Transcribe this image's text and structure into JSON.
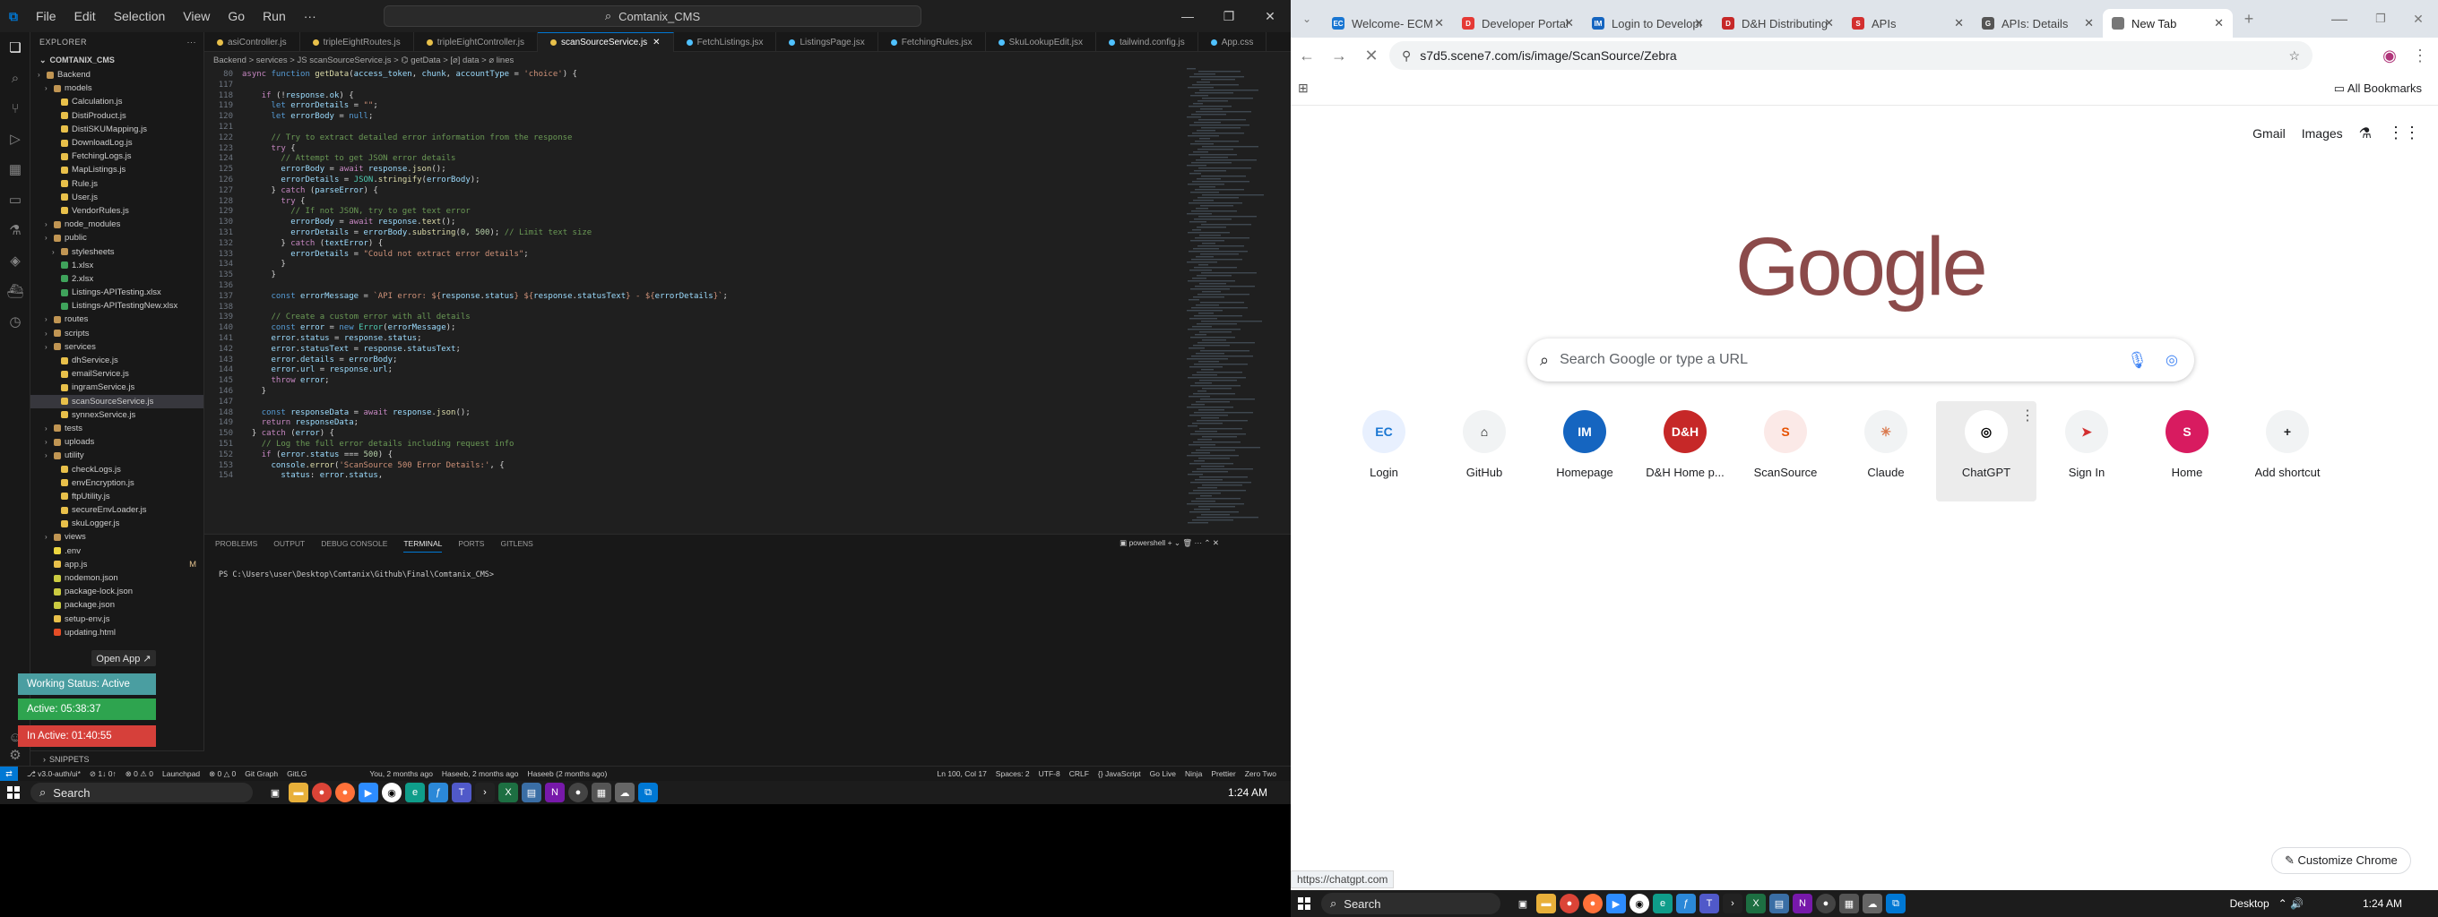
{
  "vscode": {
    "menus": [
      "File",
      "Edit",
      "Selection",
      "View",
      "Go",
      "Run",
      "···"
    ],
    "search": "Comtanix_CMS",
    "explorer_title": "EXPLORER",
    "root_folder": "COMTANIX_CMS",
    "tree": [
      {
        "label": "Backend",
        "type": "folder",
        "depth": 1
      },
      {
        "label": "models",
        "type": "folder",
        "depth": 2
      },
      {
        "label": "Calculation.js",
        "type": "js",
        "depth": 3
      },
      {
        "label": "DistiProduct.js",
        "type": "js",
        "depth": 3
      },
      {
        "label": "DistiSKUMapping.js",
        "type": "js",
        "depth": 3
      },
      {
        "label": "DownloadLog.js",
        "type": "js",
        "depth": 3
      },
      {
        "label": "FetchingLogs.js",
        "type": "js",
        "depth": 3
      },
      {
        "label": "MapListings.js",
        "type": "js",
        "depth": 3
      },
      {
        "label": "Rule.js",
        "type": "js",
        "depth": 3
      },
      {
        "label": "User.js",
        "type": "js",
        "depth": 3
      },
      {
        "label": "VendorRules.js",
        "type": "js",
        "depth": 3
      },
      {
        "label": "node_modules",
        "type": "folder",
        "depth": 2
      },
      {
        "label": "public",
        "type": "folder",
        "depth": 2
      },
      {
        "label": "stylesheets",
        "type": "folder",
        "depth": 3
      },
      {
        "label": "1.xlsx",
        "type": "xlsx",
        "depth": 3
      },
      {
        "label": "2.xlsx",
        "type": "xlsx",
        "depth": 3
      },
      {
        "label": "Listings-APITesting.xlsx",
        "type": "xlsx",
        "depth": 3
      },
      {
        "label": "Listings-APITestingNew.xlsx",
        "type": "xlsx",
        "depth": 3
      },
      {
        "label": "routes",
        "type": "folder",
        "depth": 2
      },
      {
        "label": "scripts",
        "type": "folder",
        "depth": 2
      },
      {
        "label": "services",
        "type": "folder",
        "depth": 2
      },
      {
        "label": "dhService.js",
        "type": "js",
        "depth": 3
      },
      {
        "label": "emailService.js",
        "type": "js",
        "depth": 3
      },
      {
        "label": "ingramService.js",
        "type": "js",
        "depth": 3
      },
      {
        "label": "scanSourceService.js",
        "type": "js",
        "depth": 3,
        "selected": true
      },
      {
        "label": "synnexService.js",
        "type": "js",
        "depth": 3
      },
      {
        "label": "tests",
        "type": "folder",
        "depth": 2
      },
      {
        "label": "uploads",
        "type": "folder",
        "depth": 2
      },
      {
        "label": "utility",
        "type": "folder",
        "depth": 2
      },
      {
        "label": "checkLogs.js",
        "type": "js",
        "depth": 3
      },
      {
        "label": "envEncryption.js",
        "type": "js",
        "depth": 3
      },
      {
        "label": "ftpUtility.js",
        "type": "js",
        "depth": 3
      },
      {
        "label": "secureEnvLoader.js",
        "type": "js",
        "depth": 3
      },
      {
        "label": "skuLogger.js",
        "type": "js",
        "depth": 3
      },
      {
        "label": "views",
        "type": "folder",
        "depth": 2
      },
      {
        "label": ".env",
        "type": "env",
        "depth": 2
      },
      {
        "label": "app.js",
        "type": "js",
        "depth": 2,
        "badge": "M"
      },
      {
        "label": "nodemon.json",
        "type": "json",
        "depth": 2
      },
      {
        "label": "package-lock.json",
        "type": "json",
        "depth": 2
      },
      {
        "label": "package.json",
        "type": "json",
        "depth": 2
      },
      {
        "label": "setup-env.js",
        "type": "js",
        "depth": 2
      },
      {
        "label": "updating.html",
        "type": "html",
        "depth": 2
      }
    ],
    "tabs": [
      {
        "label": "asiController.js",
        "color": "#e8c04a"
      },
      {
        "label": "tripleEightRoutes.js",
        "color": "#e8c04a"
      },
      {
        "label": "tripleEightController.js",
        "color": "#e8c04a"
      },
      {
        "label": "scanSourceService.js",
        "color": "#e8c04a",
        "active": true
      },
      {
        "label": "FetchListings.jsx",
        "color": "#4fc1ff"
      },
      {
        "label": "ListingsPage.jsx",
        "color": "#4fc1ff"
      },
      {
        "label": "FetchingRules.jsx",
        "color": "#4fc1ff"
      },
      {
        "label": "SkuLookupEdit.jsx",
        "color": "#4fc1ff"
      },
      {
        "label": "tailwind.config.js",
        "color": "#4fc1ff"
      },
      {
        "label": "App.css",
        "color": "#4fc1ff"
      }
    ],
    "breadcrumb": "Backend > services > JS scanSourceService.js > ⌬ getData > [⌀] data > ⌀ lines",
    "code_lines": [
      {
        "n": "80",
        "html": "<span class='k'>async</span> <span class='kb'>function</span> <span class='f'>getData</span>(<span class='v'>access_token</span>, <span class='v'>chunk</span>, <span class='v'>accountType</span> = <span class='s'>'choice'</span>) {"
      },
      {
        "n": "117",
        "html": ""
      },
      {
        "n": "118",
        "html": "    <span class='k'>if</span> (!<span class='v'>response</span>.<span class='v'>ok</span>) {"
      },
      {
        "n": "119",
        "html": "      <span class='kb'>let</span> <span class='v'>errorDetails</span> = <span class='s'>\"\"</span>;"
      },
      {
        "n": "120",
        "html": "      <span class='kb'>let</span> <span class='v'>errorBody</span> = <span class='kb'>null</span>;"
      },
      {
        "n": "121",
        "html": ""
      },
      {
        "n": "122",
        "html": "      <span class='c'>// Try to extract detailed error information from the response</span>"
      },
      {
        "n": "123",
        "html": "      <span class='k'>try</span> {"
      },
      {
        "n": "124",
        "html": "        <span class='c'>// Attempt to get JSON error details</span>"
      },
      {
        "n": "125",
        "html": "        <span class='v'>errorBody</span> = <span class='k'>await</span> <span class='v'>response</span>.<span class='f'>json</span>();"
      },
      {
        "n": "126",
        "html": "        <span class='v'>errorDetails</span> = <span class='t'>JSON</span>.<span class='f'>stringify</span>(<span class='v'>errorBody</span>);"
      },
      {
        "n": "127",
        "html": "      } <span class='k'>catch</span> (<span class='v'>parseError</span>) {"
      },
      {
        "n": "128",
        "html": "        <span class='k'>try</span> {"
      },
      {
        "n": "129",
        "html": "          <span class='c'>// If not JSON, try to get text error</span>"
      },
      {
        "n": "130",
        "html": "          <span class='v'>errorBody</span> = <span class='k'>await</span> <span class='v'>response</span>.<span class='f'>text</span>();"
      },
      {
        "n": "131",
        "html": "          <span class='v'>errorDetails</span> = <span class='v'>errorBody</span>.<span class='f'>substring</span>(<span class='n'>0</span>, <span class='n'>500</span>); <span class='c'>// Limit text size</span>"
      },
      {
        "n": "132",
        "html": "        } <span class='k'>catch</span> (<span class='v'>textError</span>) {"
      },
      {
        "n": "133",
        "html": "          <span class='v'>errorDetails</span> = <span class='s'>\"Could not extract error details\"</span>;"
      },
      {
        "n": "134",
        "html": "        }"
      },
      {
        "n": "135",
        "html": "      }"
      },
      {
        "n": "136",
        "html": ""
      },
      {
        "n": "137",
        "html": "      <span class='kb'>const</span> <span class='v'>errorMessage</span> = <span class='s'>`API error: ${</span><span class='v'>response</span>.<span class='v'>status</span><span class='s'>} ${</span><span class='v'>response</span>.<span class='v'>statusText</span><span class='s'>} - ${</span><span class='v'>errorDetails</span><span class='s'>}`</span>;"
      },
      {
        "n": "138",
        "html": ""
      },
      {
        "n": "139",
        "html": "      <span class='c'>// Create a custom error with all details</span>"
      },
      {
        "n": "140",
        "html": "      <span class='kb'>const</span> <span class='v'>error</span> = <span class='kb'>new</span> <span class='t'>Error</span>(<span class='v'>errorMessage</span>);"
      },
      {
        "n": "141",
        "html": "      <span class='v'>error</span>.<span class='v'>status</span> = <span class='v'>response</span>.<span class='v'>status</span>;"
      },
      {
        "n": "142",
        "html": "      <span class='v'>error</span>.<span class='v'>statusText</span> = <span class='v'>response</span>.<span class='v'>statusText</span>;"
      },
      {
        "n": "143",
        "html": "      <span class='v'>error</span>.<span class='v'>details</span> = <span class='v'>errorBody</span>;"
      },
      {
        "n": "144",
        "html": "      <span class='v'>error</span>.<span class='v'>url</span> = <span class='v'>response</span>.<span class='v'>url</span>;"
      },
      {
        "n": "145",
        "html": "      <span class='k'>throw</span> <span class='v'>error</span>;"
      },
      {
        "n": "146",
        "html": "    }"
      },
      {
        "n": "147",
        "html": ""
      },
      {
        "n": "148",
        "html": "    <span class='kb'>const</span> <span class='v'>responseData</span> = <span class='k'>await</span> <span class='v'>response</span>.<span class='f'>json</span>();"
      },
      {
        "n": "149",
        "html": "    <span class='k'>return</span> <span class='v'>responseData</span>;"
      },
      {
        "n": "150",
        "html": "  } <span class='k'>catch</span> (<span class='v'>error</span>) {"
      },
      {
        "n": "151",
        "html": "    <span class='c'>// Log the full error details including request info</span>"
      },
      {
        "n": "152",
        "html": "    <span class='k'>if</span> (<span class='v'>error</span>.<span class='v'>status</span> === <span class='n'>500</span>) {"
      },
      {
        "n": "153",
        "html": "      <span class='v'>console</span>.<span class='f'>error</span>(<span class='s'>'ScanSource 500 Error Details:'</span>, {"
      },
      {
        "n": "154",
        "html": "        <span class='v'>status</span>: <span class='v'>error</span>.<span class='v'>status</span>,"
      }
    ],
    "panel_tabs": [
      "PROBLEMS",
      "OUTPUT",
      "DEBUG CONSOLE",
      "TERMINAL",
      "PORTS",
      "GITLENS"
    ],
    "panel_active": "TERMINAL",
    "terminal_shell": "powershell",
    "terminal_prompt": "PS C:\\Users\\user\\Desktop\\Comtanix\\Github\\Final\\Comtanix_CMS>",
    "outline_label": "SNIPPETS",
    "status_items_left": [
      "⎇ v3.0-auth/ui*",
      "⊘ 1↓ 0↑",
      "⊗ 0 ⚠ 0",
      "Launchpad",
      "⊗ 0 △ 0",
      "Git Graph",
      "GitLG"
    ],
    "status_items_mid": [
      "You, 2 months ago",
      "Haseeb, 2 months ago",
      "Haseeb (2 months ago)"
    ],
    "status_items_right": [
      "Ln 100, Col 17",
      "Spaces: 2",
      "UTF-8",
      "CRLF",
      "{} JavaScript",
      "Go Live",
      "Ninja",
      "Prettier",
      "Zero Two"
    ]
  },
  "widgets": {
    "open_app": "Open App ↗",
    "working_status": "Working Status: Active",
    "active_time": "Active: 05:38:37",
    "inactive_time": "In Active: 01:40:55",
    "colors": {
      "working": "#4a9ea1",
      "active": "#2ea44f",
      "inactive": "#d6403a"
    }
  },
  "taskbar_left": {
    "search": "Search",
    "clock": "1:24 AM"
  },
  "chrome": {
    "tabs": [
      {
        "label": "Welcome- ECM",
        "fav": "EC",
        "color": "#1976d2"
      },
      {
        "label": "Developer Portal",
        "fav": "D",
        "color": "#e53935"
      },
      {
        "label": "Login to Developer",
        "fav": "IM",
        "color": "#1565c0"
      },
      {
        "label": "D&H Distributing",
        "fav": "D",
        "color": "#c62828"
      },
      {
        "label": "APIs",
        "fav": "S",
        "color": "#d32f2f"
      },
      {
        "label": "APIs: Details",
        "fav": "G",
        "color": "#555"
      },
      {
        "label": "New Tab",
        "fav": "",
        "color": "#777",
        "active": true
      }
    ],
    "url": "s7d5.scene7.com/is/image/ScanSource/Zebra",
    "all_bookmarks": "All Bookmarks",
    "top_links": [
      "Gmail",
      "Images"
    ],
    "logo": "Google",
    "search_placeholder": "Search Google or type a URL",
    "shortcuts": [
      {
        "label": "Login",
        "icon": "EC",
        "color": "#1976d2",
        "bg": "#e8f0fe"
      },
      {
        "label": "GitHub",
        "icon": "⌂",
        "color": "#000",
        "bg": "#f1f3f4"
      },
      {
        "label": "Homepage",
        "icon": "IM",
        "color": "#fff",
        "bg": "#1565c0"
      },
      {
        "label": "D&H Home p...",
        "icon": "D&H",
        "color": "#fff",
        "bg": "#c62828"
      },
      {
        "label": "ScanSource",
        "icon": "S",
        "color": "#e65100",
        "bg": "#fbe9e7"
      },
      {
        "label": "Claude",
        "icon": "✳",
        "color": "#d9774b",
        "bg": "#f1f3f4"
      },
      {
        "label": "ChatGPT",
        "icon": "◎",
        "color": "#000",
        "bg": "#fff",
        "hover": true
      },
      {
        "label": "Sign In",
        "icon": "➤",
        "color": "#d32f2f",
        "bg": "#f1f3f4"
      },
      {
        "label": "Home",
        "icon": "S",
        "color": "#fff",
        "bg": "#d81b60"
      },
      {
        "label": "Add shortcut",
        "icon": "+",
        "color": "#202124",
        "bg": "#f1f3f4"
      }
    ],
    "hover_url": "https://chatgpt.com",
    "customize": "✎ Customize Chrome"
  },
  "taskbar_right": {
    "search": "Search",
    "desktop": "Desktop",
    "clock": "1:24 AM"
  }
}
